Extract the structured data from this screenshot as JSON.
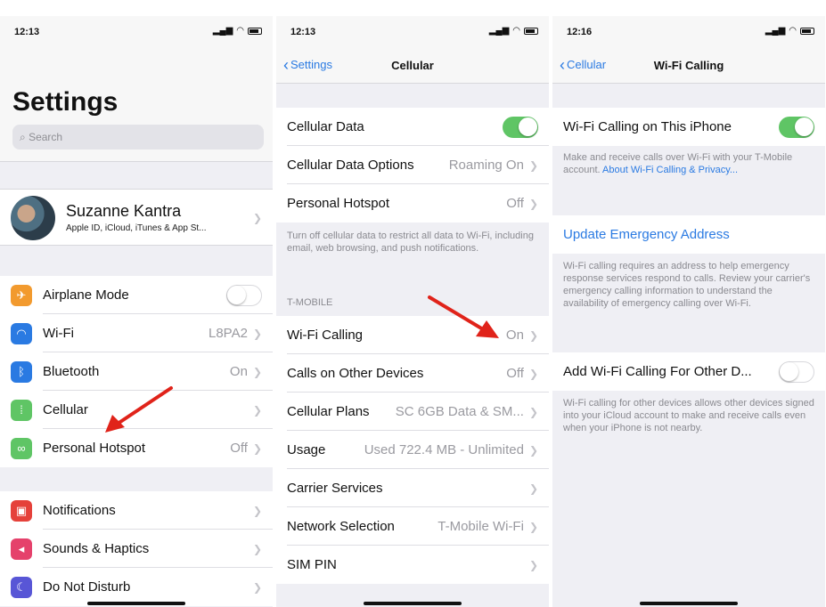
{
  "colors": {
    "ios_blue": "#2a7ae2",
    "toggle_on": "#5fc565",
    "arrow_red": "#e0231a"
  },
  "panel1": {
    "time": "12:13",
    "title": "Settings",
    "search_placeholder": "Search",
    "profile": {
      "name": "Suzanne Kantra",
      "subtitle": "Apple ID, iCloud, iTunes & App St..."
    },
    "items": [
      {
        "label": "Airplane Mode",
        "value": "",
        "icon": "airplane-icon",
        "color": "#f29a2e"
      },
      {
        "label": "Wi-Fi",
        "value": "L8PA2",
        "icon": "wifi-icon",
        "color": "#2a7ae2"
      },
      {
        "label": "Bluetooth",
        "value": "On",
        "icon": "bluetooth-icon",
        "color": "#2a7ae2"
      },
      {
        "label": "Cellular",
        "value": "",
        "icon": "cellular-icon",
        "color": "#5fc565"
      },
      {
        "label": "Personal Hotspot",
        "value": "Off",
        "icon": "hotspot-icon",
        "color": "#5fc565"
      },
      {
        "label": "Notifications",
        "value": "",
        "icon": "notifications-icon",
        "color": "#e5413a"
      },
      {
        "label": "Sounds & Haptics",
        "value": "",
        "icon": "sound-icon",
        "color": "#e5416b"
      },
      {
        "label": "Do Not Disturb",
        "value": "",
        "icon": "moon-icon",
        "color": "#5856d6"
      }
    ]
  },
  "panel2": {
    "time": "12:13",
    "back_label": "Settings",
    "title": "Cellular",
    "rows_top": [
      {
        "label": "Cellular Data",
        "value": ""
      },
      {
        "label": "Cellular Data Options",
        "value": "Roaming On"
      },
      {
        "label": "Personal Hotspot",
        "value": "Off"
      }
    ],
    "note": "Turn off cellular data to restrict all data to Wi-Fi, including email, web browsing, and push notifications.",
    "section_header": "T-MOBILE",
    "rows_bottom": [
      {
        "label": "Wi-Fi Calling",
        "value": "On"
      },
      {
        "label": "Calls on Other Devices",
        "value": "Off"
      },
      {
        "label": "Cellular Plans",
        "value": "SC 6GB Data & SM..."
      },
      {
        "label": "Usage",
        "value": "Used 722.4 MB - Unlimited"
      },
      {
        "label": "Carrier Services",
        "value": ""
      },
      {
        "label": "Network Selection",
        "value": "T-Mobile Wi-Fi"
      },
      {
        "label": "SIM PIN",
        "value": ""
      }
    ]
  },
  "panel3": {
    "time": "12:16",
    "back_label": "Cellular",
    "title": "Wi-Fi Calling",
    "wifi_calling_label": "Wi-Fi Calling on This iPhone",
    "note1_text": "Make and receive calls over Wi-Fi with your T-Mobile account.",
    "note1_link": "About Wi-Fi Calling & Privacy...",
    "update_address_label": "Update Emergency Address",
    "note2": "Wi-Fi calling requires an address to help emergency response services respond to calls. Review your carrier's emergency calling information to understand the availability of emergency calling over Wi-Fi.",
    "other_devices_label": "Add Wi-Fi Calling For Other D...",
    "note3": "Wi-Fi calling for other devices allows other devices signed into your iCloud account to make and receive calls even when your iPhone is not nearby."
  }
}
